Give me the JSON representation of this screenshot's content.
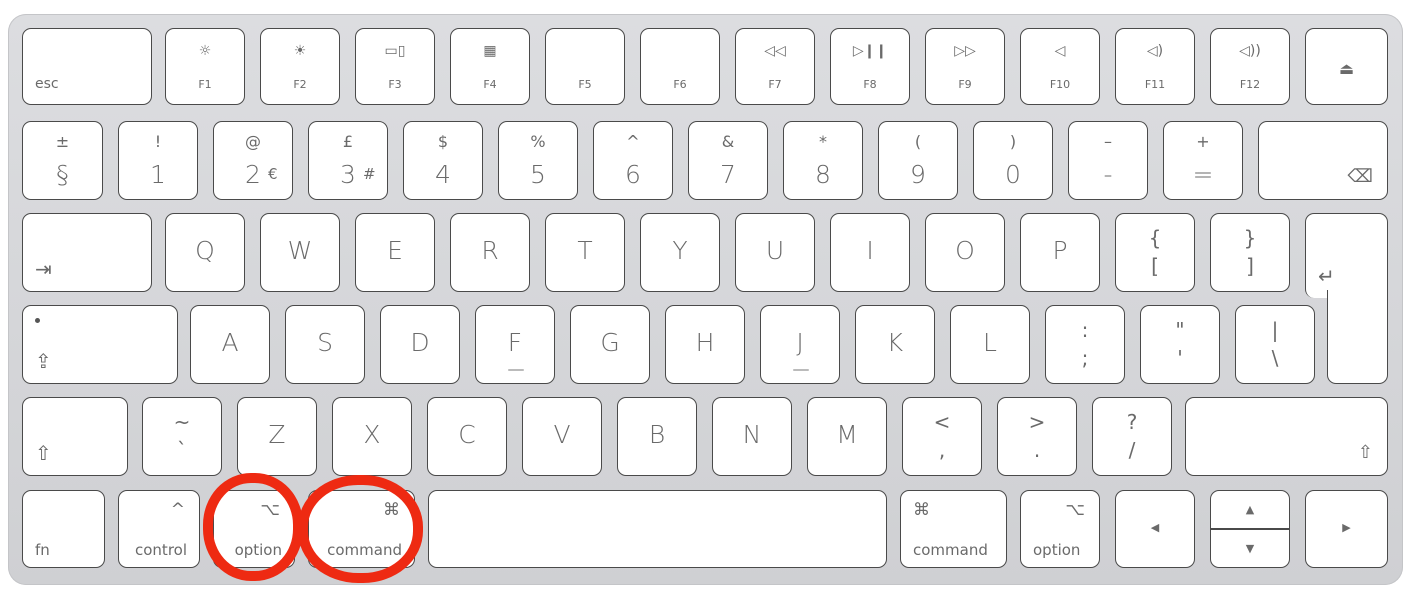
{
  "highlight_color": "#ee2a12",
  "highlighted_keys": [
    "option",
    "command"
  ],
  "rows": {
    "function": [
      {
        "label": "esc"
      },
      {
        "label": "F1",
        "icon": "brightness-down-icon",
        "glyph": "☼"
      },
      {
        "label": "F2",
        "icon": "brightness-up-icon",
        "glyph": "☀"
      },
      {
        "label": "F3",
        "icon": "mission-control-icon",
        "glyph": "▭▯"
      },
      {
        "label": "F4",
        "icon": "launchpad-icon",
        "glyph": "▦"
      },
      {
        "label": "F5"
      },
      {
        "label": "F6"
      },
      {
        "label": "F7",
        "icon": "rewind-icon",
        "glyph": "◁◁"
      },
      {
        "label": "F8",
        "icon": "play-pause-icon",
        "glyph": "▷❙❙"
      },
      {
        "label": "F9",
        "icon": "fast-forward-icon",
        "glyph": "▷▷"
      },
      {
        "label": "F10",
        "icon": "mute-icon",
        "glyph": "◁"
      },
      {
        "label": "F11",
        "icon": "volume-down-icon",
        "glyph": "◁)"
      },
      {
        "label": "F12",
        "icon": "volume-up-icon",
        "glyph": "◁))"
      },
      {
        "icon": "eject-icon",
        "glyph": "⏏"
      }
    ],
    "number": [
      {
        "top": "±",
        "main": "§"
      },
      {
        "top": "!",
        "main": "1"
      },
      {
        "top": "@",
        "main": "2",
        "alt": "€"
      },
      {
        "top": "£",
        "main": "3",
        "alt": "#"
      },
      {
        "top": "$",
        "main": "4"
      },
      {
        "top": "%",
        "main": "5"
      },
      {
        "top": "^",
        "main": "6"
      },
      {
        "top": "&",
        "main": "7"
      },
      {
        "top": "*",
        "main": "8"
      },
      {
        "top": "(",
        "main": "9"
      },
      {
        "top": ")",
        "main": "0"
      },
      {
        "top": "–",
        "main": "-"
      },
      {
        "top": "+",
        "main": "="
      },
      {
        "icon": "delete-icon",
        "glyph": "⌫"
      }
    ],
    "qwerty": [
      {
        "icon": "tab-icon",
        "glyph": "⇥"
      },
      {
        "main": "Q"
      },
      {
        "main": "W"
      },
      {
        "main": "E"
      },
      {
        "main": "R"
      },
      {
        "main": "T"
      },
      {
        "main": "Y"
      },
      {
        "main": "U"
      },
      {
        "main": "I"
      },
      {
        "main": "O"
      },
      {
        "main": "P"
      },
      {
        "top": "{",
        "main": "["
      },
      {
        "top": "}",
        "main": "]"
      },
      {
        "icon": "return-icon",
        "glyph": "↵"
      }
    ],
    "home": [
      {
        "icon": "caps-lock-icon",
        "glyph": "⇪"
      },
      {
        "main": "A"
      },
      {
        "main": "S"
      },
      {
        "main": "D"
      },
      {
        "main": "F"
      },
      {
        "main": "G"
      },
      {
        "main": "H"
      },
      {
        "main": "J"
      },
      {
        "main": "K"
      },
      {
        "main": "L"
      },
      {
        "top": ":",
        "main": ";"
      },
      {
        "top": "\"",
        "main": "'"
      },
      {
        "top": "|",
        "main": "\\"
      }
    ],
    "shift": [
      {
        "icon": "shift-icon",
        "glyph": "⇧"
      },
      {
        "top": "~",
        "main": "`"
      },
      {
        "main": "Z"
      },
      {
        "main": "X"
      },
      {
        "main": "C"
      },
      {
        "main": "V"
      },
      {
        "main": "B"
      },
      {
        "main": "N"
      },
      {
        "main": "M"
      },
      {
        "top": "<",
        "main": ","
      },
      {
        "top": ">",
        "main": "."
      },
      {
        "top": "?",
        "main": "/"
      },
      {
        "icon": "shift-icon",
        "glyph": "⇧"
      }
    ],
    "bottom": [
      {
        "label": "fn"
      },
      {
        "label": "control",
        "icon": "control-icon",
        "glyph": "^"
      },
      {
        "label": "option",
        "icon": "option-icon",
        "glyph": "⌥"
      },
      {
        "label": "command",
        "icon": "command-icon",
        "glyph": "⌘"
      },
      {},
      {
        "label": "command",
        "icon": "command-icon",
        "glyph": "⌘"
      },
      {
        "label": "option",
        "icon": "option-icon",
        "glyph": "⌥"
      },
      {
        "icon": "arrow-left-icon",
        "glyph": "◀"
      },
      {
        "icon": "arrow-up-icon",
        "glyph": "▲"
      },
      {
        "icon": "arrow-down-icon",
        "glyph": "▼"
      },
      {
        "icon": "arrow-right-icon",
        "glyph": "▶"
      }
    ]
  }
}
